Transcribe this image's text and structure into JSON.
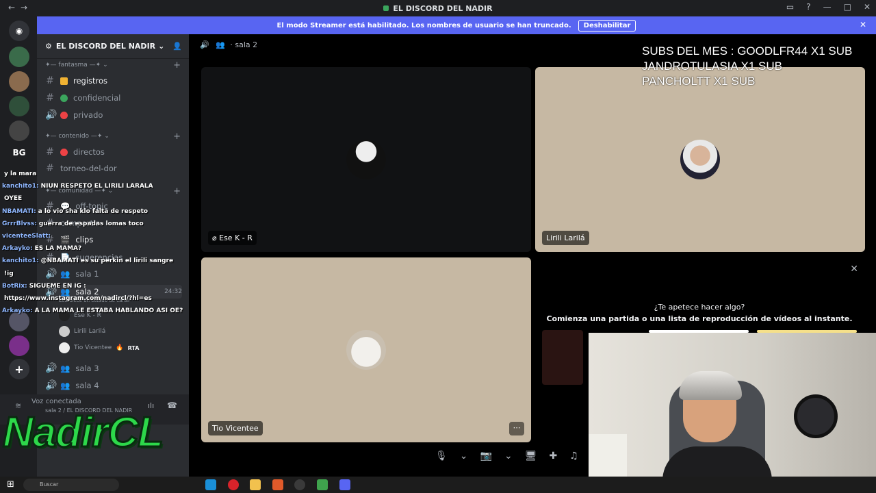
{
  "window": {
    "title": "EL DISCORD DEL NADIR"
  },
  "banner": {
    "message": "El modo Streamer está habilitado. Los nombres de usuario se han truncado.",
    "disable_label": "Deshabilitar"
  },
  "rail": {
    "bg_label": "BG"
  },
  "guild": {
    "name": "EL DISCORD DEL NADIR"
  },
  "sidebar": {
    "cat1": "fantasma",
    "cat2": "contenido",
    "cat3": "comunidad",
    "channels": [
      {
        "name": "registros"
      },
      {
        "name": "confidencial"
      },
      {
        "name": "privado"
      },
      {
        "name": "directos"
      },
      {
        "name": "torneo-del-dor"
      },
      {
        "name": "off-topic"
      },
      {
        "name": "compartir"
      },
      {
        "name": "clips"
      },
      {
        "name": "sugerencias"
      },
      {
        "name": "sala 1"
      },
      {
        "name": "sala 2"
      },
      {
        "name": "sala 3"
      },
      {
        "name": "sala 4"
      }
    ],
    "sala2_time": "24:32",
    "sala2_status": "Establece un estado de canal",
    "members": [
      {
        "name": "Ese K - R"
      },
      {
        "name": "Lirili Larilá"
      },
      {
        "name": "Tio Vicentee",
        "badge": "RTA"
      }
    ]
  },
  "voice_panel": {
    "status": "Voz conectada",
    "location": "sala 2 / EL DISCORD DEL NADIR"
  },
  "main": {
    "channel": "sala 2",
    "tiles": [
      {
        "name": "Ese K - R"
      },
      {
        "name": "Lirili Larilá"
      },
      {
        "name": "Tio Vicentee"
      }
    ],
    "activity_title": "¿Te apetece hacer algo?",
    "activity_body": "Comienza una partida o una lista de reproducción de vídeos al instante."
  },
  "overlay": {
    "subs": [
      "SUBS DEL MES : GOODLFR44 X1 SUB",
      "JANDROTULASIA X1 SUB",
      "PANCHOLTT X1 SUB"
    ],
    "chat": [
      {
        "user": "",
        "msg": "y la mara"
      },
      {
        "user": "kanchito1:",
        "msg": "NIUN RESPETO EL LIRILI LARALA"
      },
      {
        "user": "",
        "msg": "OYEE"
      },
      {
        "user": "NBAMATI:",
        "msg": "a lo vio sha klo falta de respeto"
      },
      {
        "user": "GrrrBlvss:",
        "msg": "guerra de espadas lomas toco"
      },
      {
        "user": "vicenteeSlatt:",
        "msg": ""
      },
      {
        "user": "Arkayko:",
        "msg": "ES LA MAMA?"
      },
      {
        "user": "kanchito1:",
        "msg": "@NBAMATI es su perkin el lirili sangre"
      },
      {
        "user": "",
        "msg": "!ig"
      },
      {
        "user": "BotRix:",
        "msg": "SIGUEME EN iG :"
      },
      {
        "user": "",
        "msg": "https://www.instagram.com/nadircl/?hl=es"
      },
      {
        "user": "Arkayko:",
        "msg": "A LA MAMA LE ESTABA HABLANDO ASI OE?"
      }
    ],
    "logo": "NadirCL"
  },
  "taskbar": {
    "search_placeholder": "Buscar"
  },
  "colors": {
    "blurple": "#5865f2",
    "sidebar": "#2b2d31",
    "rail": "#1e1f22",
    "green": "#2dd84a",
    "tile_beige": "#c6b8a3"
  }
}
